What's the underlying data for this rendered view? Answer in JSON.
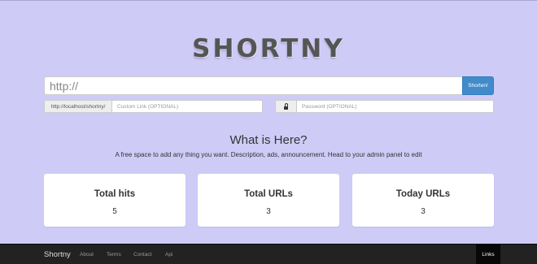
{
  "header": {
    "logo": "SHORTNY"
  },
  "shorten_form": {
    "url_placeholder": "http://",
    "submit_label": "Shorten!",
    "custom_prefix": "http://localhost/shortny/",
    "custom_placeholder": "Custom Link (OPTIONAL)",
    "password_icon": "lock-icon",
    "password_placeholder": "Password (OPTIONAL)"
  },
  "info": {
    "title": "What is Here?",
    "text": "A free space to add any thing you want. Description, ads, announcement. Head to your admin panel to edit"
  },
  "stats": [
    {
      "label": "Total hits",
      "value": "5"
    },
    {
      "label": "Total URLs",
      "value": "3"
    },
    {
      "label": "Today URLs",
      "value": "3"
    }
  ],
  "footer": {
    "brand": "Shortny",
    "nav": [
      "About",
      "Terms",
      "Contact",
      "Api"
    ],
    "right_link": "Links"
  },
  "colors": {
    "background": "#cfcbf7",
    "button": "#428bca",
    "footer": "#222222"
  }
}
